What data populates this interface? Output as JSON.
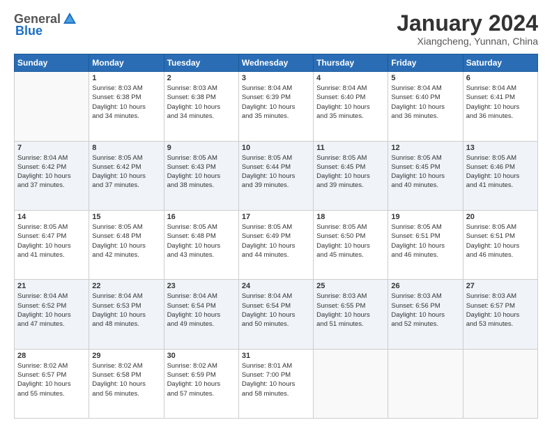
{
  "header": {
    "logo_general": "General",
    "logo_blue": "Blue",
    "month_title": "January 2024",
    "location": "Xiangcheng, Yunnan, China"
  },
  "days_of_week": [
    "Sunday",
    "Monday",
    "Tuesday",
    "Wednesday",
    "Thursday",
    "Friday",
    "Saturday"
  ],
  "weeks": [
    [
      {
        "day": "",
        "info": ""
      },
      {
        "day": "1",
        "info": "Sunrise: 8:03 AM\nSunset: 6:38 PM\nDaylight: 10 hours\nand 34 minutes."
      },
      {
        "day": "2",
        "info": "Sunrise: 8:03 AM\nSunset: 6:38 PM\nDaylight: 10 hours\nand 34 minutes."
      },
      {
        "day": "3",
        "info": "Sunrise: 8:04 AM\nSunset: 6:39 PM\nDaylight: 10 hours\nand 35 minutes."
      },
      {
        "day": "4",
        "info": "Sunrise: 8:04 AM\nSunset: 6:40 PM\nDaylight: 10 hours\nand 35 minutes."
      },
      {
        "day": "5",
        "info": "Sunrise: 8:04 AM\nSunset: 6:40 PM\nDaylight: 10 hours\nand 36 minutes."
      },
      {
        "day": "6",
        "info": "Sunrise: 8:04 AM\nSunset: 6:41 PM\nDaylight: 10 hours\nand 36 minutes."
      }
    ],
    [
      {
        "day": "7",
        "info": "Sunrise: 8:04 AM\nSunset: 6:42 PM\nDaylight: 10 hours\nand 37 minutes."
      },
      {
        "day": "8",
        "info": "Sunrise: 8:05 AM\nSunset: 6:42 PM\nDaylight: 10 hours\nand 37 minutes."
      },
      {
        "day": "9",
        "info": "Sunrise: 8:05 AM\nSunset: 6:43 PM\nDaylight: 10 hours\nand 38 minutes."
      },
      {
        "day": "10",
        "info": "Sunrise: 8:05 AM\nSunset: 6:44 PM\nDaylight: 10 hours\nand 39 minutes."
      },
      {
        "day": "11",
        "info": "Sunrise: 8:05 AM\nSunset: 6:45 PM\nDaylight: 10 hours\nand 39 minutes."
      },
      {
        "day": "12",
        "info": "Sunrise: 8:05 AM\nSunset: 6:45 PM\nDaylight: 10 hours\nand 40 minutes."
      },
      {
        "day": "13",
        "info": "Sunrise: 8:05 AM\nSunset: 6:46 PM\nDaylight: 10 hours\nand 41 minutes."
      }
    ],
    [
      {
        "day": "14",
        "info": "Sunrise: 8:05 AM\nSunset: 6:47 PM\nDaylight: 10 hours\nand 41 minutes."
      },
      {
        "day": "15",
        "info": "Sunrise: 8:05 AM\nSunset: 6:48 PM\nDaylight: 10 hours\nand 42 minutes."
      },
      {
        "day": "16",
        "info": "Sunrise: 8:05 AM\nSunset: 6:48 PM\nDaylight: 10 hours\nand 43 minutes."
      },
      {
        "day": "17",
        "info": "Sunrise: 8:05 AM\nSunset: 6:49 PM\nDaylight: 10 hours\nand 44 minutes."
      },
      {
        "day": "18",
        "info": "Sunrise: 8:05 AM\nSunset: 6:50 PM\nDaylight: 10 hours\nand 45 minutes."
      },
      {
        "day": "19",
        "info": "Sunrise: 8:05 AM\nSunset: 6:51 PM\nDaylight: 10 hours\nand 46 minutes."
      },
      {
        "day": "20",
        "info": "Sunrise: 8:05 AM\nSunset: 6:51 PM\nDaylight: 10 hours\nand 46 minutes."
      }
    ],
    [
      {
        "day": "21",
        "info": "Sunrise: 8:04 AM\nSunset: 6:52 PM\nDaylight: 10 hours\nand 47 minutes."
      },
      {
        "day": "22",
        "info": "Sunrise: 8:04 AM\nSunset: 6:53 PM\nDaylight: 10 hours\nand 48 minutes."
      },
      {
        "day": "23",
        "info": "Sunrise: 8:04 AM\nSunset: 6:54 PM\nDaylight: 10 hours\nand 49 minutes."
      },
      {
        "day": "24",
        "info": "Sunrise: 8:04 AM\nSunset: 6:54 PM\nDaylight: 10 hours\nand 50 minutes."
      },
      {
        "day": "25",
        "info": "Sunrise: 8:03 AM\nSunset: 6:55 PM\nDaylight: 10 hours\nand 51 minutes."
      },
      {
        "day": "26",
        "info": "Sunrise: 8:03 AM\nSunset: 6:56 PM\nDaylight: 10 hours\nand 52 minutes."
      },
      {
        "day": "27",
        "info": "Sunrise: 8:03 AM\nSunset: 6:57 PM\nDaylight: 10 hours\nand 53 minutes."
      }
    ],
    [
      {
        "day": "28",
        "info": "Sunrise: 8:02 AM\nSunset: 6:57 PM\nDaylight: 10 hours\nand 55 minutes."
      },
      {
        "day": "29",
        "info": "Sunrise: 8:02 AM\nSunset: 6:58 PM\nDaylight: 10 hours\nand 56 minutes."
      },
      {
        "day": "30",
        "info": "Sunrise: 8:02 AM\nSunset: 6:59 PM\nDaylight: 10 hours\nand 57 minutes."
      },
      {
        "day": "31",
        "info": "Sunrise: 8:01 AM\nSunset: 7:00 PM\nDaylight: 10 hours\nand 58 minutes."
      },
      {
        "day": "",
        "info": ""
      },
      {
        "day": "",
        "info": ""
      },
      {
        "day": "",
        "info": ""
      }
    ]
  ]
}
